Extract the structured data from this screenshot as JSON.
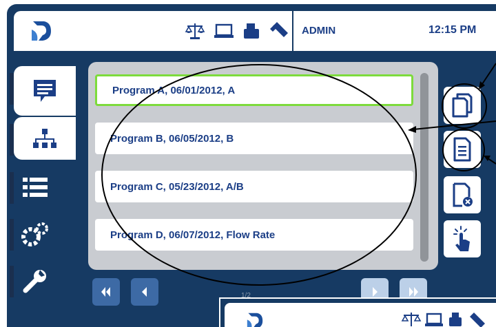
{
  "header": {
    "user": "ADMIN",
    "time": "12:15 PM",
    "status_icons": [
      "balance-icon",
      "laptop-icon",
      "printer-icon",
      "usb-icon"
    ]
  },
  "nav": {
    "items": [
      {
        "name": "messages",
        "icon": "message-icon"
      },
      {
        "name": "programs",
        "icon": "hierarchy-icon",
        "selected": true
      },
      {
        "name": "list",
        "icon": "list-icon"
      },
      {
        "name": "settings",
        "icon": "gears-icon"
      },
      {
        "name": "tools",
        "icon": "wrench-icon"
      }
    ]
  },
  "programs": [
    {
      "label": "Program A, 06/01/2012, A",
      "selected": true
    },
    {
      "label": "Program B, 06/05/2012, B"
    },
    {
      "label": "Program C, 05/23/2012, A/B"
    },
    {
      "label": "Program D, 06/07/2012, Flow Rate"
    }
  ],
  "actions": [
    {
      "name": "copy-program",
      "icon": "copy-icon"
    },
    {
      "name": "edit-program",
      "icon": "document-icon"
    },
    {
      "name": "delete-program",
      "icon": "document-delete-icon"
    },
    {
      "name": "run-program",
      "icon": "touch-icon"
    }
  ],
  "pager": {
    "indicator": "1/2"
  },
  "colors": {
    "frame": "#163a63",
    "accent_text": "#1b3e86",
    "selected_border": "#7ddb3c",
    "panel": "#c9ccd1"
  }
}
